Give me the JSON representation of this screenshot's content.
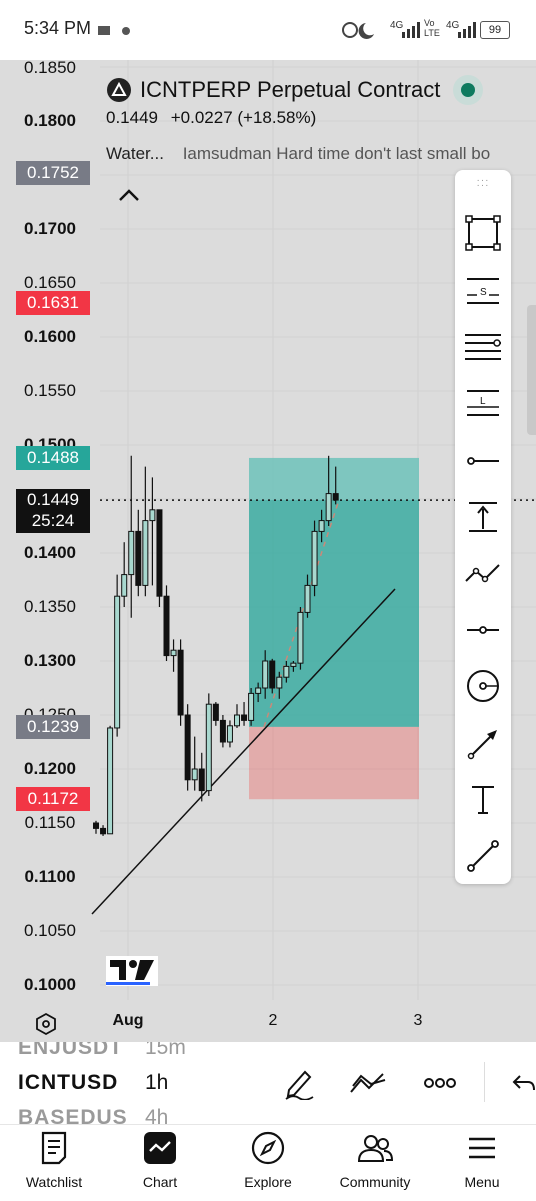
{
  "status_bar": {
    "time": "5:34 PM",
    "battery": "99",
    "network_labels": [
      "4G",
      "Vo LTE",
      "4G"
    ]
  },
  "header": {
    "title": "ICNTPERP Perpetual Contract",
    "price": "0.1449",
    "change": "+0.0227 (+18.58%)",
    "watermark_label": "Water...",
    "watermark_text": "Iamsudman Hard time don't last small bo"
  },
  "price_axis": {
    "ticks": [
      "0.1850",
      "0.1800",
      "0.1752",
      "0.1700",
      "0.1650",
      "0.1631",
      "0.1600",
      "0.1550",
      "0.1500",
      "0.1488",
      "0.1449",
      "0.1400",
      "0.1350",
      "0.1300",
      "0.1250",
      "0.1239",
      "0.1200",
      "0.1172",
      "0.1150",
      "0.1100",
      "0.1050",
      "0.1000"
    ],
    "tags": {
      "position_top": "0.1752",
      "stop_loss_label": "0.1631",
      "take_profit": "0.1488",
      "current_price": "0.1449",
      "countdown": "25:24",
      "entry": "0.1239",
      "stop_loss": "0.1172"
    }
  },
  "time_axis": {
    "labels": [
      "Aug",
      "2",
      "3"
    ]
  },
  "chart_data": {
    "type": "candlestick",
    "symbol": "ICNTPERP",
    "interval": "1h",
    "ylim": [
      0.0985,
      0.186
    ],
    "xlabels": [
      "Aug",
      "2",
      "3"
    ],
    "candles": [
      {
        "o": 0.115,
        "h": 0.1152,
        "l": 0.114,
        "c": 0.1145
      },
      {
        "o": 0.1145,
        "h": 0.1148,
        "l": 0.1138,
        "c": 0.114
      },
      {
        "o": 0.114,
        "h": 0.124,
        "l": 0.114,
        "c": 0.1238
      },
      {
        "o": 0.1238,
        "h": 0.138,
        "l": 0.123,
        "c": 0.136
      },
      {
        "o": 0.136,
        "h": 0.141,
        "l": 0.135,
        "c": 0.138
      },
      {
        "o": 0.138,
        "h": 0.149,
        "l": 0.134,
        "c": 0.142
      },
      {
        "o": 0.142,
        "h": 0.144,
        "l": 0.136,
        "c": 0.137
      },
      {
        "o": 0.137,
        "h": 0.148,
        "l": 0.136,
        "c": 0.143
      },
      {
        "o": 0.143,
        "h": 0.147,
        "l": 0.137,
        "c": 0.144
      },
      {
        "o": 0.144,
        "h": 0.144,
        "l": 0.135,
        "c": 0.136
      },
      {
        "o": 0.136,
        "h": 0.137,
        "l": 0.13,
        "c": 0.1305
      },
      {
        "o": 0.1305,
        "h": 0.132,
        "l": 0.129,
        "c": 0.131
      },
      {
        "o": 0.131,
        "h": 0.132,
        "l": 0.124,
        "c": 0.125
      },
      {
        "o": 0.125,
        "h": 0.126,
        "l": 0.118,
        "c": 0.119
      },
      {
        "o": 0.119,
        "h": 0.123,
        "l": 0.118,
        "c": 0.12
      },
      {
        "o": 0.12,
        "h": 0.1215,
        "l": 0.117,
        "c": 0.118
      },
      {
        "o": 0.118,
        "h": 0.127,
        "l": 0.1175,
        "c": 0.126
      },
      {
        "o": 0.126,
        "h": 0.1262,
        "l": 0.124,
        "c": 0.1245
      },
      {
        "o": 0.1245,
        "h": 0.125,
        "l": 0.122,
        "c": 0.1225
      },
      {
        "o": 0.1225,
        "h": 0.1245,
        "l": 0.122,
        "c": 0.124
      },
      {
        "o": 0.124,
        "h": 0.126,
        "l": 0.1238,
        "c": 0.125
      },
      {
        "o": 0.125,
        "h": 0.1262,
        "l": 0.124,
        "c": 0.1245
      },
      {
        "o": 0.1245,
        "h": 0.1275,
        "l": 0.124,
        "c": 0.127
      },
      {
        "o": 0.127,
        "h": 0.128,
        "l": 0.1262,
        "c": 0.1275
      },
      {
        "o": 0.1275,
        "h": 0.131,
        "l": 0.1265,
        "c": 0.13
      },
      {
        "o": 0.13,
        "h": 0.1302,
        "l": 0.127,
        "c": 0.1275
      },
      {
        "o": 0.1275,
        "h": 0.129,
        "l": 0.1265,
        "c": 0.1285
      },
      {
        "o": 0.1285,
        "h": 0.13,
        "l": 0.128,
        "c": 0.1295
      },
      {
        "o": 0.1295,
        "h": 0.13,
        "l": 0.129,
        "c": 0.1298
      },
      {
        "o": 0.1298,
        "h": 0.135,
        "l": 0.1292,
        "c": 0.1345
      },
      {
        "o": 0.1345,
        "h": 0.138,
        "l": 0.134,
        "c": 0.137
      },
      {
        "o": 0.137,
        "h": 0.143,
        "l": 0.136,
        "c": 0.142
      },
      {
        "o": 0.142,
        "h": 0.144,
        "l": 0.141,
        "c": 0.143
      },
      {
        "o": 0.143,
        "h": 0.149,
        "l": 0.1425,
        "c": 0.1455
      },
      {
        "o": 0.1455,
        "h": 0.148,
        "l": 0.1445,
        "c": 0.1449
      }
    ],
    "position": {
      "type": "long",
      "entry": 0.1239,
      "take_profit": 0.1488,
      "stop_loss": 0.1172
    },
    "colors": {
      "up": "#a8d8cf",
      "down": "#111111",
      "profit_zone": "#26a69a",
      "loss_zone": "#ef5350",
      "tp_tag": "#26a69a",
      "sl_tag": "#f23645",
      "neutral_tag": "#787b86"
    }
  },
  "toolbox": {
    "tools": [
      "selection-rectangle-icon",
      "short-position-icon",
      "parallel-lines-icon",
      "long-position-icon",
      "horizontal-ray-icon",
      "measure-icon",
      "path-icon",
      "horizontal-line-icon",
      "circle-icon",
      "arrow-icon",
      "text-icon",
      "trend-line-icon"
    ]
  },
  "symbol_bar": {
    "prev_symbol": "ENJUSDT",
    "prev_interval": "15m",
    "symbol": "ICNTUSD",
    "interval": "1h",
    "next_symbol": "BASEDUS",
    "next_interval": "4h"
  },
  "bottom_nav": {
    "items": [
      "Watchlist",
      "Chart",
      "Explore",
      "Community",
      "Menu"
    ]
  }
}
